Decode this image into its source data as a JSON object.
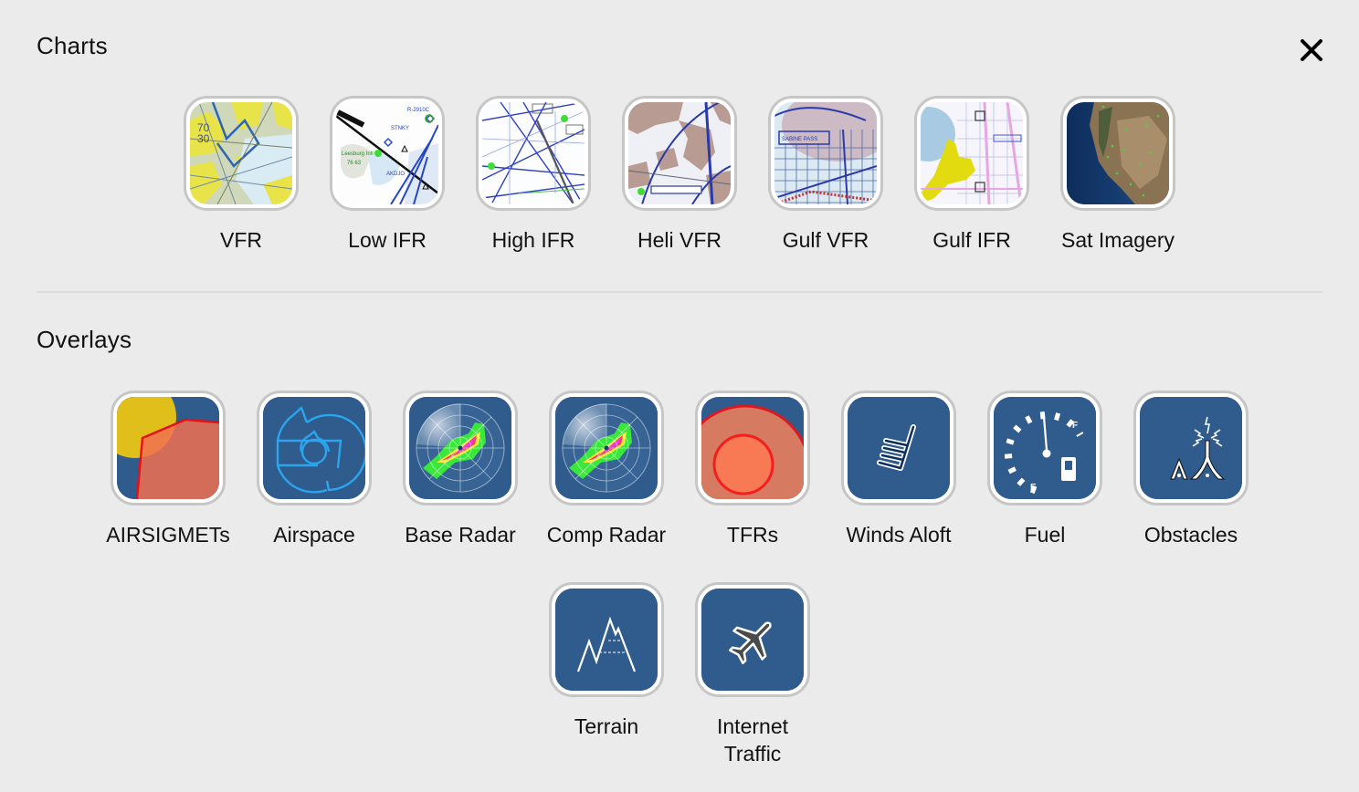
{
  "charts": {
    "title": "Charts",
    "items": [
      {
        "label": "VFR",
        "icon": "vfr-sectional-thumbnail"
      },
      {
        "label": "Low IFR",
        "icon": "low-ifr-chart-thumbnail"
      },
      {
        "label": "High IFR",
        "icon": "high-ifr-chart-thumbnail"
      },
      {
        "label": "Heli VFR",
        "icon": "heli-vfr-chart-thumbnail"
      },
      {
        "label": "Gulf VFR",
        "icon": "gulf-vfr-chart-thumbnail"
      },
      {
        "label": "Gulf IFR",
        "icon": "gulf-ifr-chart-thumbnail"
      },
      {
        "label": "Sat Imagery",
        "icon": "satellite-imagery-thumbnail"
      }
    ]
  },
  "overlays": {
    "title": "Overlays",
    "items": [
      {
        "label": "AIRSIGMETs",
        "icon": "airsigmet-icon"
      },
      {
        "label": "Airspace",
        "icon": "airspace-icon"
      },
      {
        "label": "Base Radar",
        "icon": "base-radar-icon"
      },
      {
        "label": "Comp Radar",
        "icon": "comp-radar-icon"
      },
      {
        "label": "TFRs",
        "icon": "tfr-icon"
      },
      {
        "label": "Winds Aloft",
        "icon": "wind-barb-icon"
      },
      {
        "label": "Fuel",
        "icon": "fuel-gauge-icon"
      },
      {
        "label": "Obstacles",
        "icon": "obstacle-tower-icon"
      },
      {
        "label": "Terrain",
        "icon": "terrain-mountain-icon"
      },
      {
        "label": "Internet Traffic",
        "label_lines": [
          "Internet",
          "Traffic"
        ],
        "icon": "airplane-icon"
      }
    ]
  },
  "close": {
    "icon": "close-icon",
    "glyph": "✕"
  },
  "colors": {
    "background": "#ebebeb",
    "overlay_tile_blue": "#2f5b8d",
    "tile_border": "#c6c6c6",
    "divider": "#dcdcdc"
  }
}
